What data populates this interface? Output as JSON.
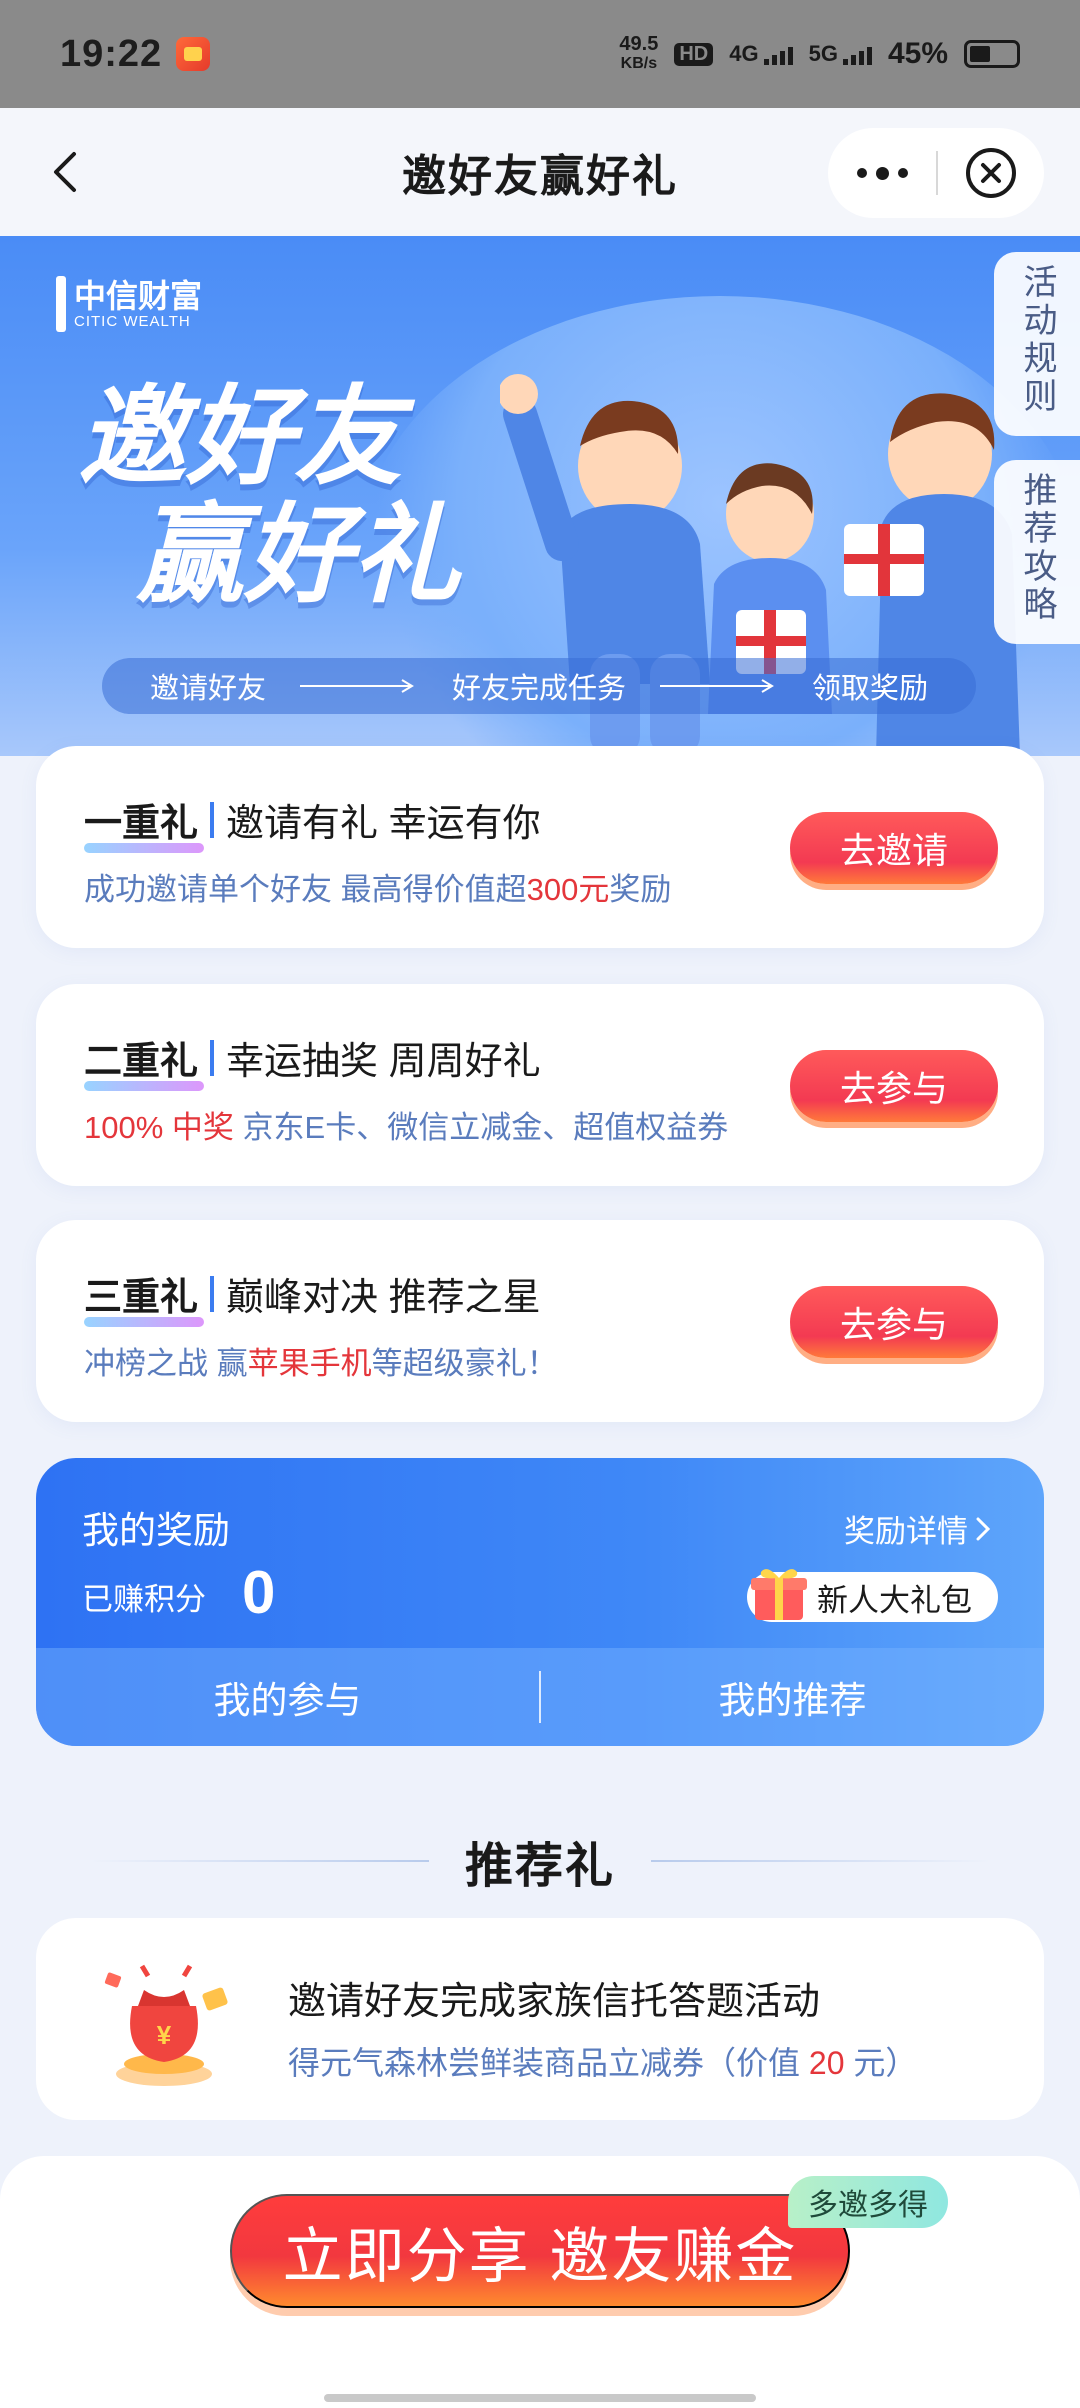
{
  "status_bar": {
    "time": "19:22",
    "speed_value": "49.5",
    "speed_unit": "KB/s",
    "hd_label": "HD",
    "network_1": "4G",
    "network_2": "5G",
    "battery": "45%"
  },
  "nav": {
    "title": "邀好友赢好礼",
    "more_icon": "more-dots-icon",
    "close_icon": "close-circle-icon"
  },
  "hero": {
    "logo_cn": "中信财富",
    "logo_en": "CITIC WEALTH",
    "headline_line1": "邀好友",
    "headline_line2": "赢好礼",
    "steps": [
      "邀请好友",
      "好友完成任务",
      "领取奖励"
    ],
    "side_tabs": [
      "活动规则",
      "推荐攻略"
    ]
  },
  "tiers": [
    {
      "tier": "一重礼",
      "title": "邀请有礼 幸运有你",
      "desc_before": "成功邀请单个好友 最高得价值超",
      "desc_highlight": "300元",
      "desc_after": "奖励",
      "button": "去邀请"
    },
    {
      "tier": "二重礼",
      "title": "幸运抽奖 周周好礼",
      "desc_before": "",
      "desc_highlight": "100% 中奖",
      "desc_after": " 京东E卡、微信立减金、超值权益券",
      "button": "去参与"
    },
    {
      "tier": "三重礼",
      "title": "巅峰对决 推荐之星",
      "desc_before": "冲榜之战  赢",
      "desc_highlight": "苹果手机",
      "desc_after": "等超级豪礼！",
      "button": "去参与"
    }
  ],
  "rewards": {
    "title": "我的奖励",
    "detail_link": "奖励详情",
    "points_label": "已赚积分",
    "points_value": "0",
    "gift_label": "新人大礼包",
    "tabs": [
      "我的参与",
      "我的推荐"
    ]
  },
  "recommend": {
    "section_title": "推荐礼",
    "item_title": "邀请好友完成家族信托答题活动",
    "item_desc_before": "得元气森林尝鲜装商品立减券（价值 ",
    "item_desc_highlight": "20",
    "item_desc_after": " 元）"
  },
  "bottom": {
    "share_button": "立即分享 邀友赚金",
    "badge": "多邀多得"
  },
  "colors": {
    "accent_blue": "#3b7cf0",
    "accent_red": "#e4363b",
    "desc_blue": "#5a7cbd"
  }
}
